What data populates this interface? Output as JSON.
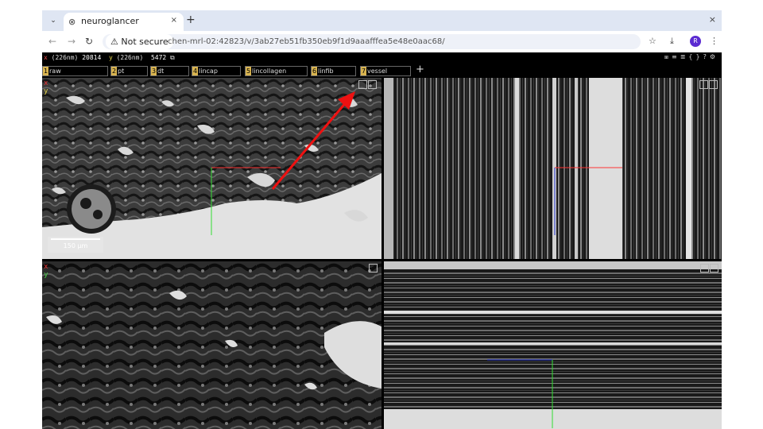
{
  "browser": {
    "tab_title": "neuroglancer",
    "tab_close": "×",
    "new_tab": "+",
    "window_close": "×",
    "security_label": "⚠ Not secure",
    "url": "chen-mrl-02:42823/v/3ab27eb51fb350eb9f1d9aaafffea5e48e0aac68/",
    "profile_initial": "R",
    "icons": [
      "tab-menu-icon",
      "favicon-icon",
      "back-icon",
      "forward-icon",
      "reload-icon",
      "bookmark-star-icon",
      "download-icon",
      "kebab-menu-icon"
    ]
  },
  "status": {
    "x_label": "x",
    "x_unit": "(226nm)",
    "x_value": "20814",
    "y_label": "y",
    "y_unit": "(226nm)",
    "y_value": "5472"
  },
  "layers": [
    {
      "num": "1",
      "name": "raw"
    },
    {
      "num": "2",
      "name": "pt"
    },
    {
      "num": "3",
      "name": "dt"
    },
    {
      "num": "4",
      "name": "lincap"
    },
    {
      "num": "5",
      "name": "lincollagen"
    },
    {
      "num": "6",
      "name": "linfib"
    },
    {
      "num": "7",
      "name": "vessel"
    }
  ],
  "add_layer": "+",
  "panels": {
    "axis_x": "x",
    "axis_y": "y",
    "scale_text": "150 µm"
  },
  "colors": {
    "axis_red": "#ff3333",
    "axis_green": "#33dd33",
    "axis_blue": "#2233cc",
    "annotation_arrow": "#ee1111",
    "layer_chip": "#d9b450"
  }
}
